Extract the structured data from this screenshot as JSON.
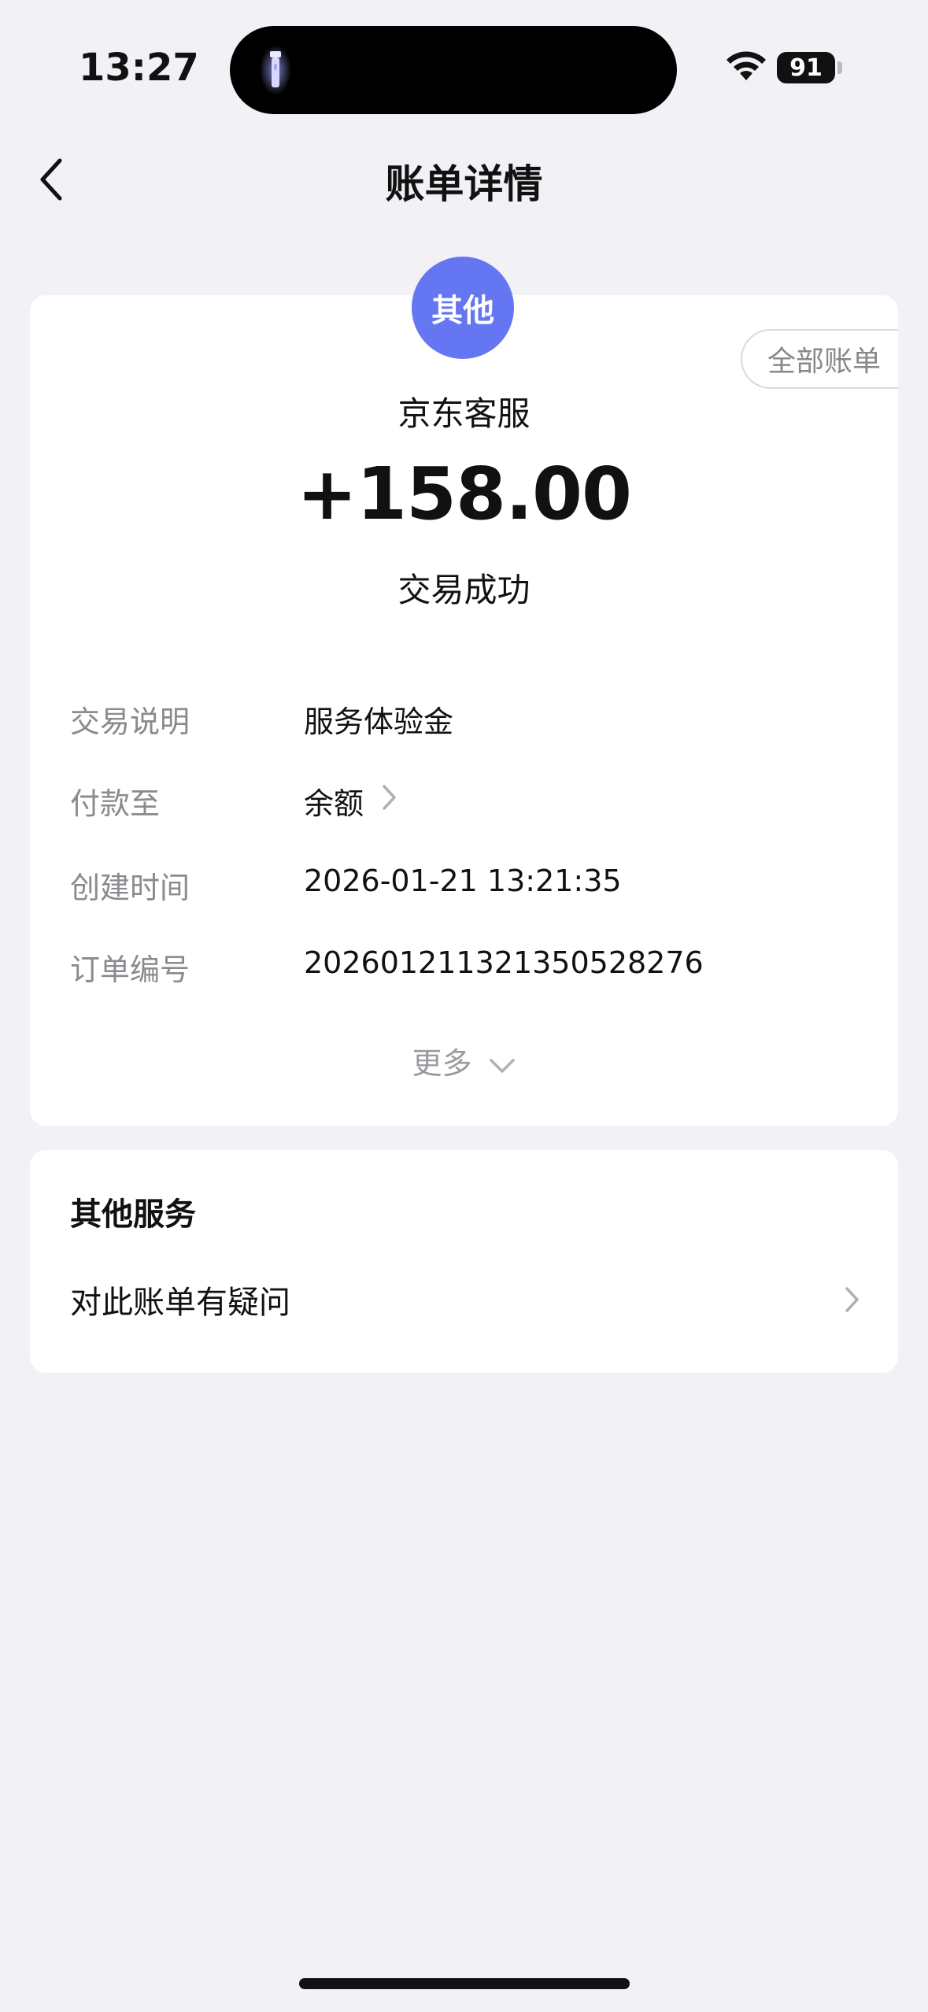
{
  "status_bar": {
    "time": "13:27",
    "battery": "91"
  },
  "nav": {
    "title": "账单详情"
  },
  "bill": {
    "avatar_label": "其他",
    "all_bills_label": "全部账单",
    "merchant": "京东客服",
    "amount": "+158.00",
    "status": "交易成功",
    "details": [
      {
        "label": "交易说明",
        "value": "服务体验金"
      },
      {
        "label": "付款至",
        "value": "余额"
      },
      {
        "label": "创建时间",
        "value": "2026-01-21 13:21:35"
      },
      {
        "label": "订单编号",
        "value": "20260121132135052827​6"
      }
    ],
    "more_label": "更多"
  },
  "services": {
    "title": "其他服务",
    "item_label": "对此账单有疑问"
  },
  "colors": {
    "background": "#f2f1f6",
    "avatar": "#6476f1",
    "label_gray": "#8a8a8f"
  },
  "icons": [
    "back-chevron-icon",
    "flashlight-icon",
    "wifi-icon",
    "battery-icon",
    "chevron-right-icon",
    "chevron-down-icon"
  ]
}
